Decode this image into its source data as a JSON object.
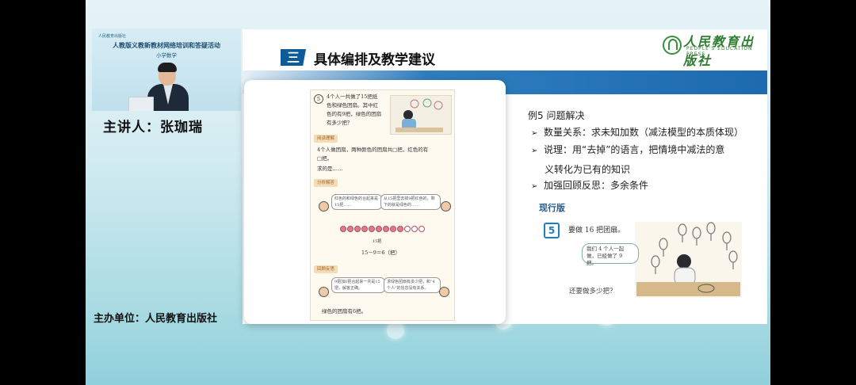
{
  "left_panel": {
    "video_small_text": "人民教育出版社",
    "video_title": "人教版义教新教材网络培训和答疑活动",
    "video_subtitle": "小学数学",
    "presenter": "主讲人：张珈瑞",
    "organizer": "主办单位：人民教育出版社"
  },
  "slide": {
    "section_number": "三",
    "section_title": "具体编排及教学建议",
    "publisher_cn": "人民教育出版社",
    "publisher_en": "PEOPLE'S EDUCATION PRESS",
    "textbook": {
      "problem_number": "5",
      "problem_text_1": "4个人一共做了15把纸",
      "problem_text_2": "色和绿色团扇。其中红",
      "problem_text_3": "色的有9把，绿色的团扇",
      "problem_text_4": "有多少把？",
      "tag_understand": "阅读理解",
      "understand_1": "4个人做团扇，两种颜色的团扇共□把，红色的有",
      "understand_2": "□把。",
      "understand_3": "求的是……",
      "tag_solve": "分析解答",
      "bubble_left": "红色的和绿色的合起来是15把……",
      "bubble_right": "从15把里去掉9把红色的，剩下的就是绿色的……",
      "bracket_label": "15把",
      "equation": "15－9＝6（把）",
      "tag_review": "回顾反思",
      "review_left": "9把加6把合起来一共是15把，解答正确。",
      "review_right": "求绿色团扇有多少把，和“4个人”的信息没有关系。",
      "answer": "绿色的团扇有6把。"
    },
    "example_title": "例5  问题解决",
    "bullets": [
      "数量关系：求未知加数（减法模型的本质体现）",
      "说理：用“去掉”的语言，把情境中减法的意",
      "加强回顾反思：多余条件"
    ],
    "bullet_2_continued": "义转化为已有的知识",
    "current_version_label": "现行版",
    "current_problem_number": "5",
    "current_problem_text": "要做 16 把团扇。",
    "current_speech": "我们 4 个人一起做，已经做了 9 把。",
    "current_question": "还要做多少把？"
  }
}
